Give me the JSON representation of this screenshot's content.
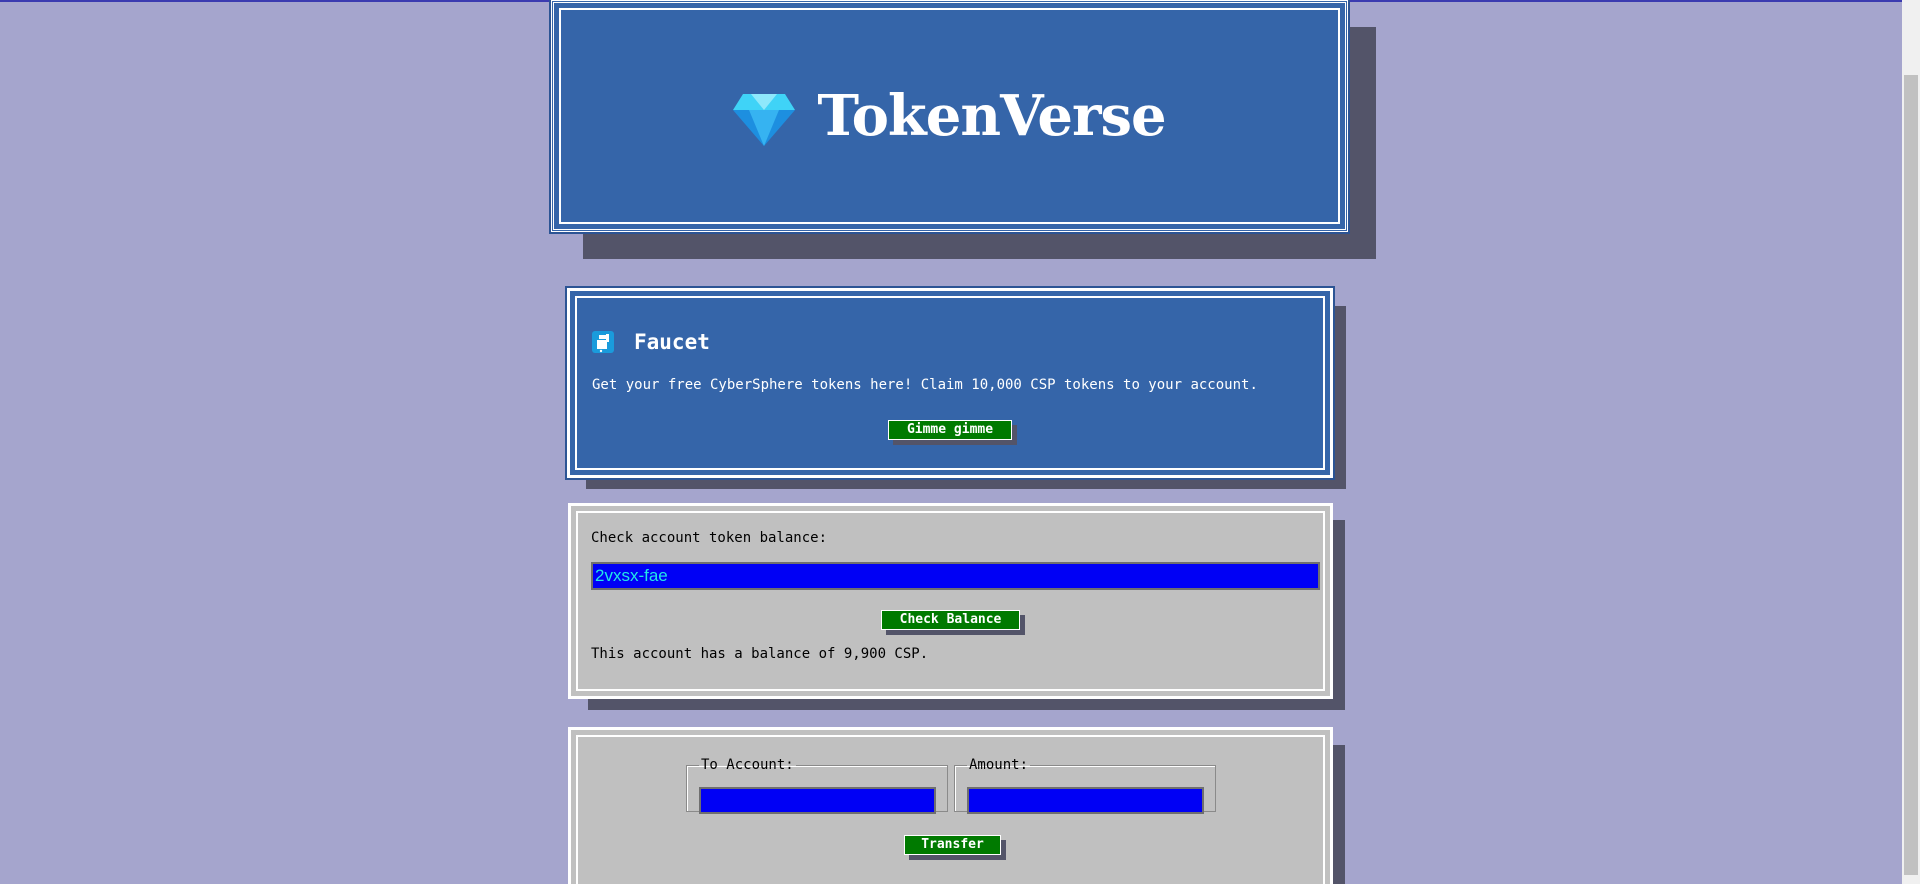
{
  "brand": {
    "title": "TokenVerse",
    "logo_icon": "gem-icon"
  },
  "faucet": {
    "icon": "faucet-icon",
    "title": "Faucet",
    "description": "Get your free CyberSphere tokens here! Claim 10,000 CSP tokens to your account.",
    "button_label": "Gimme gimme"
  },
  "balance": {
    "prompt": "Check account token balance:",
    "account_value": "2vxsx-fae",
    "button_label": "Check Balance",
    "result": "This account has a balance of 9,900 CSP."
  },
  "transfer": {
    "to_account_legend": "To Account:",
    "to_account_value": "",
    "amount_legend": "Amount:",
    "amount_value": "",
    "button_label": "Transfer"
  },
  "colors": {
    "page_background": "#a5a5cd",
    "panel_blue": "#3565a9",
    "panel_gray": "#c0c0c0",
    "button_green": "#007a00",
    "input_blue": "#0000f5",
    "shadow": "#535469"
  }
}
